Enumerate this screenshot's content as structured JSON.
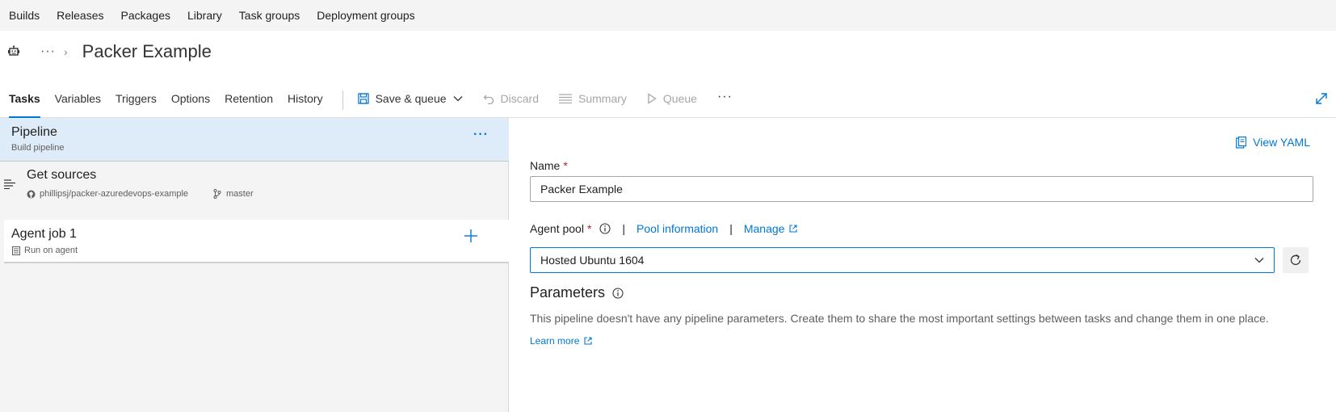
{
  "topnav": {
    "items": [
      "Builds",
      "Releases",
      "Packages",
      "Library",
      "Task groups",
      "Deployment groups"
    ]
  },
  "header": {
    "breadcrumb_more": "···",
    "chevron": "›",
    "title": "Packer Example"
  },
  "toolbar": {
    "tabs": [
      "Tasks",
      "Variables",
      "Triggers",
      "Options",
      "Retention",
      "History"
    ],
    "active_tab": "Tasks",
    "save_queue": "Save & queue",
    "discard": "Discard",
    "summary": "Summary",
    "queue": "Queue",
    "more": "···"
  },
  "left": {
    "pipeline": {
      "title": "Pipeline",
      "subtitle": "Build pipeline",
      "more": "···"
    },
    "sources": {
      "title": "Get sources",
      "repo": "phillipsj/packer-azuredevops-example",
      "branch": "master"
    },
    "agent_job": {
      "title": "Agent job 1",
      "subtitle": "Run on agent"
    }
  },
  "right": {
    "view_yaml": "View YAML",
    "name_label": "Name",
    "required_mark": "*",
    "name_value": "Packer Example",
    "pool_label": "Agent pool",
    "separator": "|",
    "pool_info_link": "Pool information",
    "manage_link": "Manage",
    "pool_value": "Hosted Ubuntu 1604",
    "params_title": "Parameters",
    "params_desc": "This pipeline doesn't have any pipeline parameters. Create them to share the most important settings between tasks and change them in one place.",
    "learn_more": "Learn more"
  },
  "colors": {
    "accent": "#0078d4",
    "selected_row": "#deecf9",
    "panel_bg": "#f4f4f4",
    "required": "#a4262c"
  }
}
